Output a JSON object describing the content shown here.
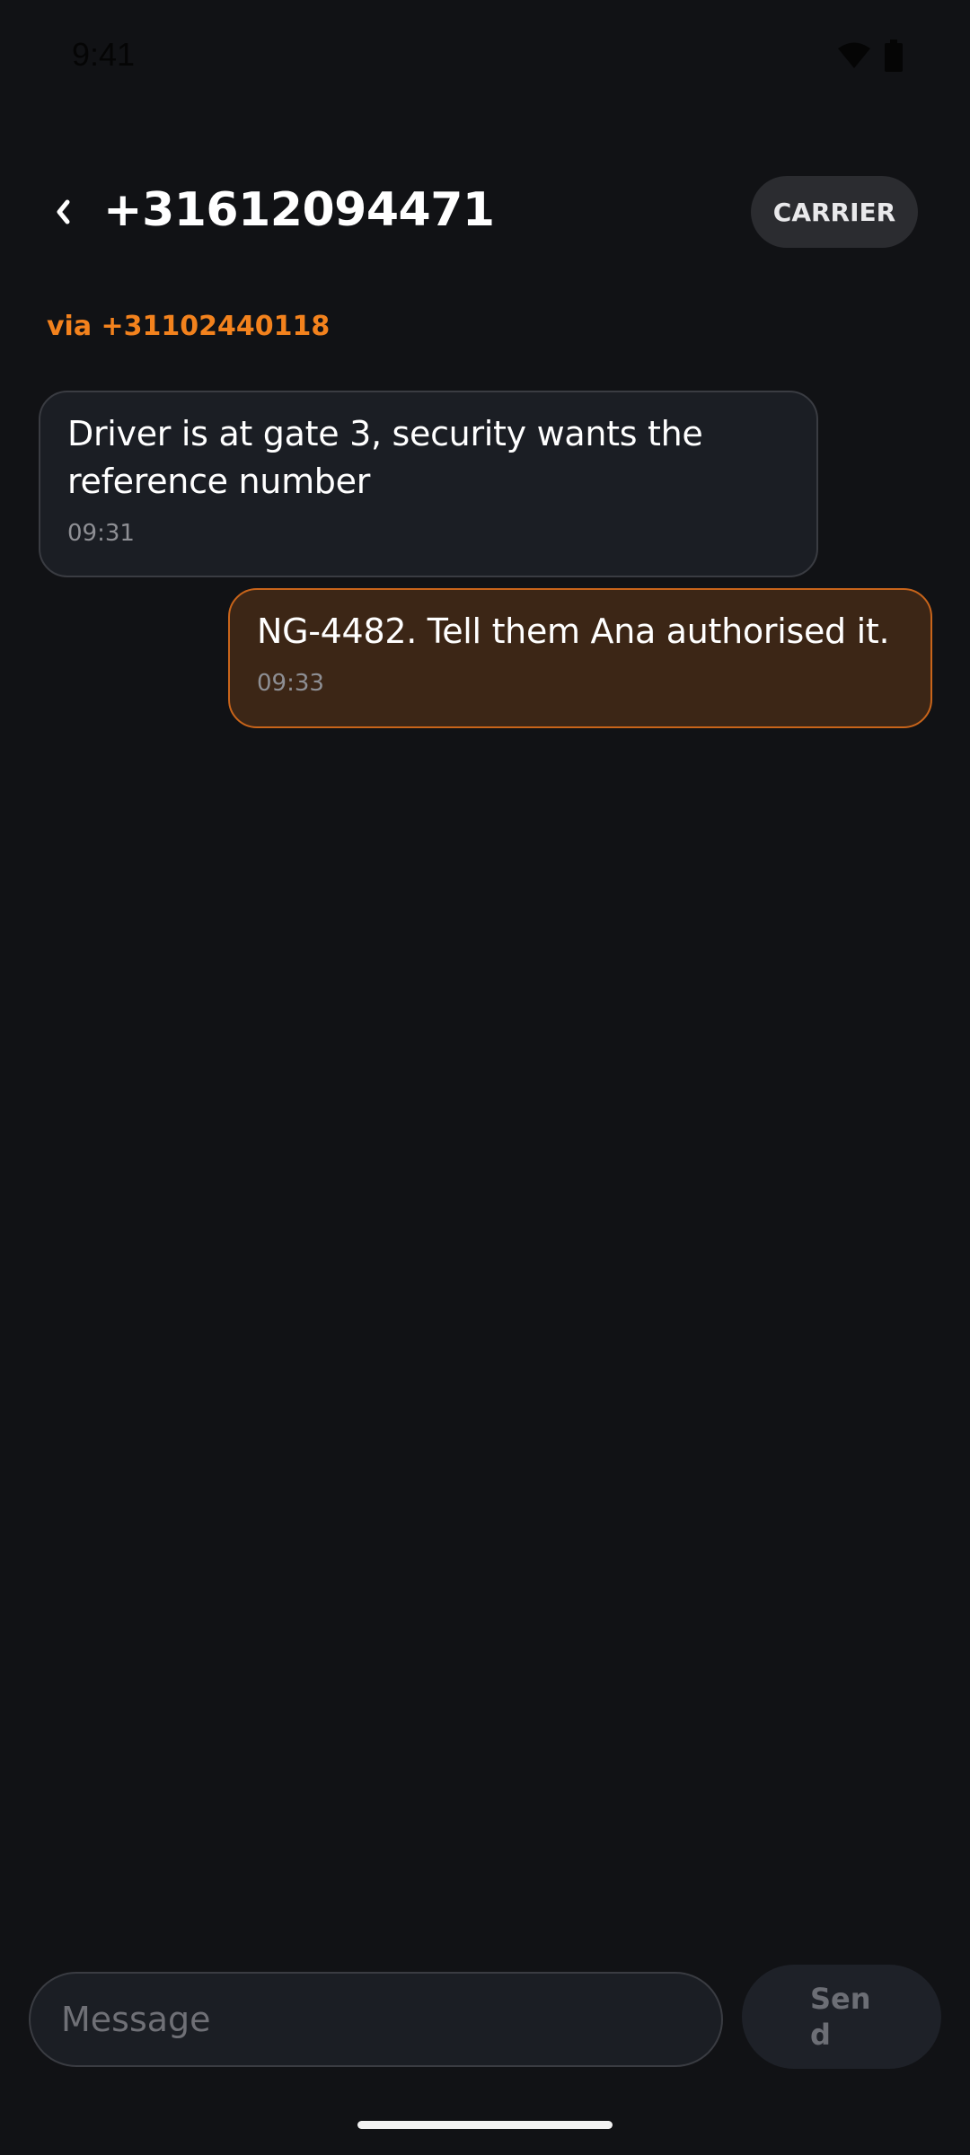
{
  "status_bar": {
    "time": "9:41",
    "icons": [
      "wifi-icon",
      "battery-icon"
    ]
  },
  "header": {
    "back_icon": "chevron-left-icon",
    "title": "+31612094471",
    "carrier_label": "CARRIER"
  },
  "via_label": "via +31102440118",
  "messages": [
    {
      "direction": "incoming",
      "text": "Driver is at gate 3, security wants the reference number",
      "time": "09:31"
    },
    {
      "direction": "outgoing",
      "text": "NG-4482. Tell them Ana authorised it.",
      "time": "09:33"
    }
  ],
  "composer": {
    "placeholder": "Message",
    "value": "",
    "send_label": "Send"
  },
  "colors": {
    "background": "#111215",
    "accent": "#f3821d",
    "incoming_bubble": "#1b1e24",
    "outgoing_bubble": "#3c2616",
    "outgoing_border": "#c8641a"
  }
}
